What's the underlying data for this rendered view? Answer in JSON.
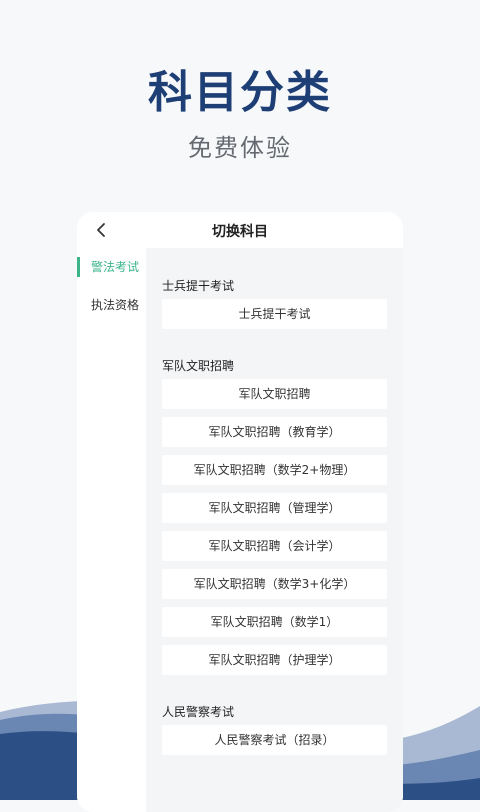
{
  "headline": "科目分类",
  "subline": "免费体验",
  "navbar": {
    "title": "切换科目",
    "back_icon": "chevron-left-icon"
  },
  "sidebar": {
    "items": [
      {
        "label": "警法考试",
        "active": true
      },
      {
        "label": "执法资格",
        "active": false
      }
    ]
  },
  "groups": [
    {
      "title": "士兵提干考试",
      "items": [
        "士兵提干考试"
      ]
    },
    {
      "title": "军队文职招聘",
      "items": [
        "军队文职招聘",
        "军队文职招聘（教育学）",
        "军队文职招聘（数学2+物理）",
        "军队文职招聘（管理学）",
        "军队文职招聘（会计学）",
        "军队文职招聘（数学3+化学）",
        "军队文职招聘（数学1）",
        "军队文职招聘（护理学）"
      ]
    },
    {
      "title": "人民警察考试",
      "items": [
        "人民警察考试（招录）"
      ]
    }
  ],
  "colors": {
    "accent": "#3cb48a",
    "headline": "#1e3f75",
    "wave": "#2c4f86"
  }
}
